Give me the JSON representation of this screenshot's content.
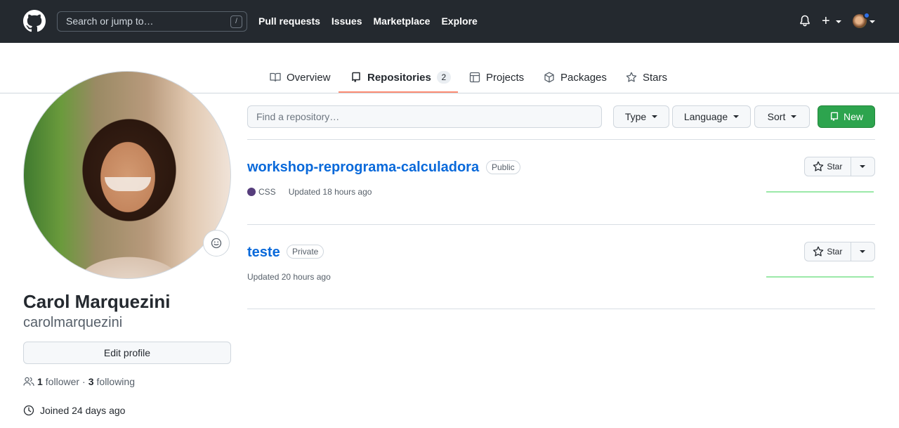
{
  "header": {
    "search_placeholder": "Search or jump to…",
    "search_shortcut": "/",
    "nav": [
      "Pull requests",
      "Issues",
      "Marketplace",
      "Explore"
    ],
    "plus": "+"
  },
  "tabs": [
    {
      "label": "Overview",
      "icon": "book-icon"
    },
    {
      "label": "Repositories",
      "icon": "repo-icon",
      "count": "2",
      "active": true
    },
    {
      "label": "Projects",
      "icon": "table-icon"
    },
    {
      "label": "Packages",
      "icon": "package-icon"
    },
    {
      "label": "Stars",
      "icon": "star-icon"
    }
  ],
  "profile": {
    "full_name": "Carol Marquezini",
    "username": "carolmarquezini",
    "edit_label": "Edit profile",
    "followers_count": "1",
    "followers_label": "follower",
    "separator": "·",
    "following_count": "3",
    "following_label": "following",
    "joined": "Joined 24 days ago"
  },
  "filters": {
    "find_placeholder": "Find a repository…",
    "type": "Type",
    "language": "Language",
    "sort": "Sort",
    "new": "New"
  },
  "repos": [
    {
      "name": "workshop-reprograma-calculadora",
      "visibility": "Public",
      "language": "CSS",
      "language_color": "#563d7c",
      "updated": "Updated 18 hours ago",
      "star_label": "Star"
    },
    {
      "name": "teste",
      "visibility": "Private",
      "updated": "Updated 20 hours ago",
      "star_label": "Star"
    }
  ],
  "colors": {
    "header_bg": "#24292f",
    "link": "#0969da",
    "primary_button": "#2da44e",
    "tab_underline": "#fd8c73"
  }
}
